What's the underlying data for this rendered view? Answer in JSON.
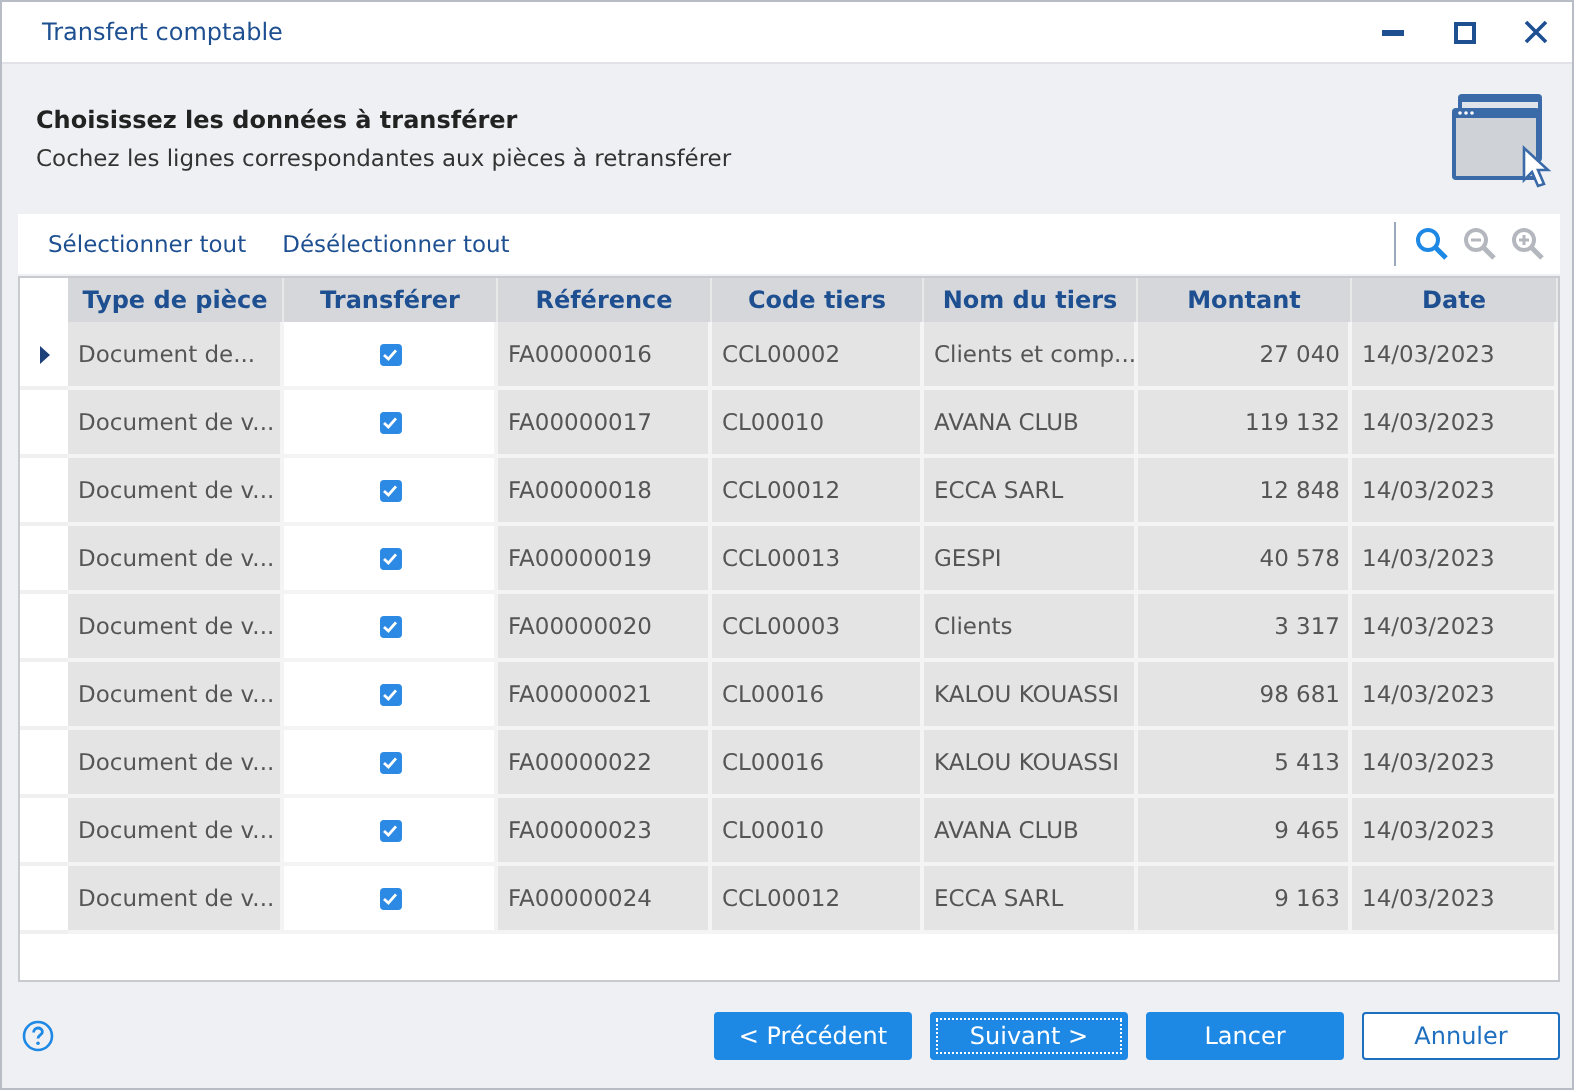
{
  "window": {
    "title": "Transfert comptable"
  },
  "header": {
    "title": "Choisissez les données à transférer",
    "subtitle": "Cochez les lignes correspondantes aux pièces à retransférer"
  },
  "toolbar": {
    "actions": [
      "Sélectionner tout",
      "Désélectionner tout"
    ]
  },
  "table": {
    "columns": [
      "Type de pièce",
      "Transférer",
      "Référence",
      "Code tiers",
      "Nom du tiers",
      "Montant",
      "Date"
    ],
    "rows": [
      {
        "current": true,
        "type": "Document de...",
        "checked": true,
        "reference": "FA00000016",
        "code": "CCL00002",
        "name": "Clients et comp...",
        "amount": "27 040",
        "date": "14/03/2023"
      },
      {
        "current": false,
        "type": "Document de v...",
        "checked": true,
        "reference": "FA00000017",
        "code": "CL00010",
        "name": "AVANA CLUB",
        "amount": "119 132",
        "date": "14/03/2023"
      },
      {
        "current": false,
        "type": "Document de v...",
        "checked": true,
        "reference": "FA00000018",
        "code": "CCL00012",
        "name": "ECCA SARL",
        "amount": "12 848",
        "date": "14/03/2023"
      },
      {
        "current": false,
        "type": "Document de v...",
        "checked": true,
        "reference": "FA00000019",
        "code": "CCL00013",
        "name": "GESPI",
        "amount": "40 578",
        "date": "14/03/2023"
      },
      {
        "current": false,
        "type": "Document de v...",
        "checked": true,
        "reference": "FA00000020",
        "code": "CCL00003",
        "name": "Clients",
        "amount": "3 317",
        "date": "14/03/2023"
      },
      {
        "current": false,
        "type": "Document de v...",
        "checked": true,
        "reference": "FA00000021",
        "code": "CL00016",
        "name": "KALOU KOUASSI",
        "amount": "98 681",
        "date": "14/03/2023"
      },
      {
        "current": false,
        "type": "Document de v...",
        "checked": true,
        "reference": "FA00000022",
        "code": "CL00016",
        "name": "KALOU KOUASSI",
        "amount": "5 413",
        "date": "14/03/2023"
      },
      {
        "current": false,
        "type": "Document de v...",
        "checked": true,
        "reference": "FA00000023",
        "code": "CL00010",
        "name": "AVANA CLUB",
        "amount": "9 465",
        "date": "14/03/2023"
      },
      {
        "current": false,
        "type": "Document de v...",
        "checked": true,
        "reference": "FA00000024",
        "code": "CCL00012",
        "name": "ECCA SARL",
        "amount": "9 163",
        "date": "14/03/2023"
      }
    ]
  },
  "buttons": [
    {
      "label": "< Précédent",
      "kind": "primary",
      "focused": false
    },
    {
      "label": "Suivant >",
      "kind": "primary",
      "focused": true
    },
    {
      "label": "Lancer",
      "kind": "primary",
      "focused": false
    },
    {
      "label": "Annuler",
      "kind": "secondary",
      "focused": false
    }
  ]
}
